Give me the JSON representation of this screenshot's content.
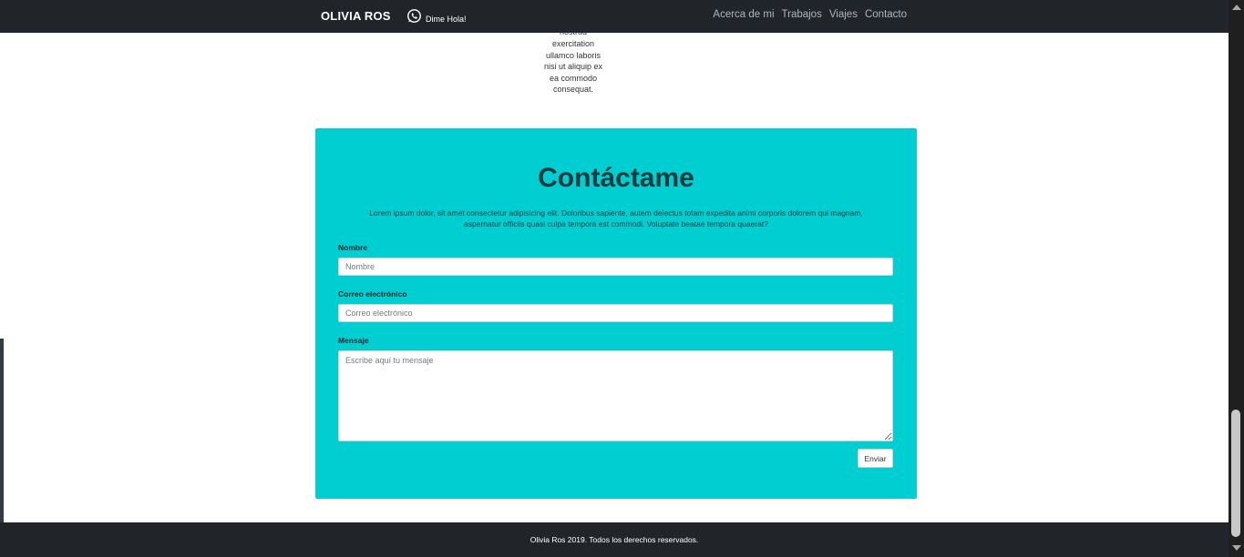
{
  "navbar": {
    "brand": "OLIVIA ROS",
    "whatsapp_label": "Dime Hola!",
    "whatsapp_icon": "whatsapp-icon",
    "links": [
      "Acerca de mi",
      "Trabajos",
      "Viajes",
      "Contacto"
    ]
  },
  "snippet": {
    "partial_line": "nostrud",
    "lines": [
      "exercitation",
      "ullamco laboris",
      "nisi ut aliquip ex",
      "ea commodo",
      "consequat."
    ]
  },
  "contact": {
    "title": "Contáctame",
    "intro": "Lorem ipsum dolor, sit amet consectetur adipisicing elit. Doloribus sapiente, autem delectus totam expedita animi corporis dolorem qui magnam, aspernatur officiis quasi culpa tempora est commodi. Voluptate beatae tempora quaerat?",
    "name_label": "Nombre",
    "name_placeholder": "Nombre",
    "email_label": "Correo electrónico",
    "email_placeholder": "Correo electrónico",
    "message_label": "Mensaje",
    "message_placeholder": "Escribe aquí tu mensaje",
    "submit_label": "Enviar",
    "background_color": "#00ced1"
  },
  "footer": {
    "text": "Olivia Ros 2019. Todos los derechos reservados."
  }
}
